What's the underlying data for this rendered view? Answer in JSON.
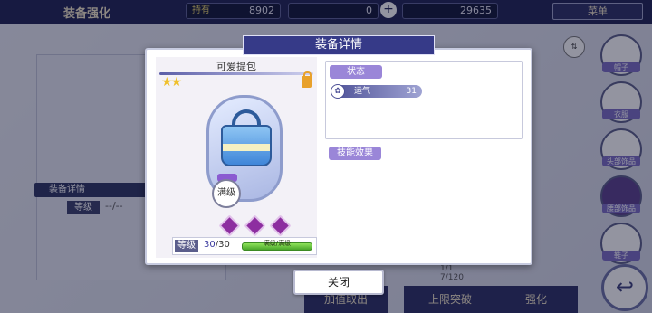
{
  "header": {
    "title": "装备强化",
    "resources": [
      {
        "label": "持有",
        "value": "8902"
      },
      {
        "label": "",
        "value": "0"
      },
      {
        "label": "",
        "value": "29635"
      }
    ],
    "menu_label": "菜单"
  },
  "background": {
    "equip_detail_label": "装备详情",
    "level_label": "等级",
    "level_value": "--/--",
    "page_indicator": "1/1",
    "page_count": "7/120",
    "bottom_buttons": [
      "加值取出",
      "上限突破",
      "强化"
    ],
    "side_categories": [
      "帽子",
      "衣服",
      "头部饰品",
      "腰部饰品",
      "鞋子"
    ]
  },
  "dialog": {
    "title": "装备详情",
    "item": {
      "name": "可爱提包",
      "stars": 2,
      "max_level_badge": "满级",
      "gem_count": 3,
      "level_label": "等级",
      "level_current": "30",
      "level_max": "/30",
      "level_bar_text": "满级/满级",
      "level_progress": 1.0
    },
    "status": {
      "section_label": "状态",
      "stats": [
        {
          "name": "运气",
          "value": "31"
        }
      ]
    },
    "skill": {
      "section_label": "技能效果"
    },
    "close_label": "关闭"
  },
  "colors": {
    "header_bg": "#1e2252",
    "title_bar": "#363a88",
    "tag_purple": "#9a86d8",
    "level_bar": "#4aa72b"
  }
}
